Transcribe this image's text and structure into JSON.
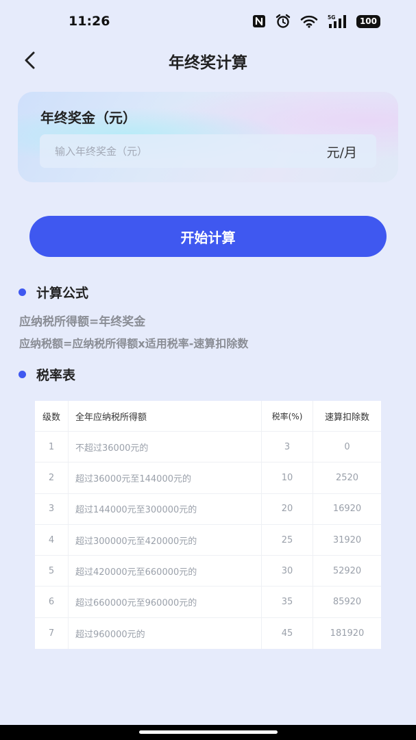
{
  "status_bar": {
    "time": "11:26",
    "icons": [
      "nfc-icon",
      "alarm-icon",
      "wifi-icon",
      "5g-signal-icon"
    ],
    "network": "5G",
    "battery": "100"
  },
  "header": {
    "back_icon": "chevron-left-icon",
    "title": "年终奖计算"
  },
  "input_card": {
    "label": "年终奖金（元）",
    "placeholder": "输入年终奖金（元）",
    "value": "",
    "unit": "元/月"
  },
  "calculate_button": {
    "label": "开始计算"
  },
  "formula_section": {
    "title": "计算公式",
    "lines": [
      "应纳税所得额=年终奖金",
      "应纳税额=应纳税所得额x适用税率-速算扣除数"
    ]
  },
  "rate_section": {
    "title": "税率表",
    "headers": [
      "级数",
      "全年应纳税所得额",
      "税率(%)",
      "速算扣除数"
    ],
    "rows": [
      [
        "1",
        "不超过36000元的",
        "3",
        "0"
      ],
      [
        "2",
        "超过36000元至144000元的",
        "10",
        "2520"
      ],
      [
        "3",
        "超过144000元至300000元的",
        "20",
        "16920"
      ],
      [
        "4",
        "超过300000元至420000元的",
        "25",
        "31920"
      ],
      [
        "5",
        "超过420000元至660000元的",
        "30",
        "52920"
      ],
      [
        "6",
        "超过660000元至960000元的",
        "35",
        "85920"
      ],
      [
        "7",
        "超过960000元的",
        "45",
        "181920"
      ]
    ]
  },
  "colors": {
    "background": "#e6ebfb",
    "accent": "#3f58f0",
    "text_primary": "#222222",
    "text_secondary": "#8a8d95"
  }
}
